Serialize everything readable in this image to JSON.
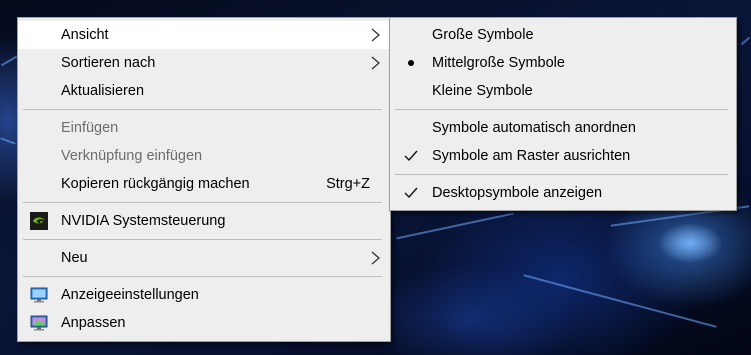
{
  "context_menu": {
    "items": [
      {
        "label": "Ansicht"
      },
      {
        "label": "Sortieren nach"
      },
      {
        "label": "Aktualisieren"
      },
      {
        "label": "Einfügen"
      },
      {
        "label": "Verknüpfung einfügen"
      },
      {
        "label": "Kopieren rückgängig machen",
        "shortcut": "Strg+Z"
      },
      {
        "label": "NVIDIA Systemsteuerung"
      },
      {
        "label": "Neu"
      },
      {
        "label": "Anzeigeeinstellungen"
      },
      {
        "label": "Anpassen"
      }
    ]
  },
  "view_submenu": {
    "items": [
      {
        "label": "Große Symbole"
      },
      {
        "label": "Mittelgroße Symbole",
        "selected": true
      },
      {
        "label": "Kleine Symbole"
      },
      {
        "label": "Symbole automatisch anordnen"
      },
      {
        "label": "Symbole am Raster ausrichten",
        "checked": true
      },
      {
        "label": "Desktopsymbole anzeigen",
        "checked": true
      }
    ]
  },
  "icons": {
    "nvidia": "nvidia-logo-icon",
    "display": "display-settings-icon",
    "personalize": "personalize-icon",
    "submenu_arrow": "chevron-right-icon",
    "radio": "bullet-icon",
    "check": "checkmark-icon"
  },
  "colors": {
    "menu_bg": "#eeeeee",
    "hover_bg": "#ffffff",
    "disabled_text": "#6d6d6d",
    "nvidia_green": "#76b900"
  }
}
